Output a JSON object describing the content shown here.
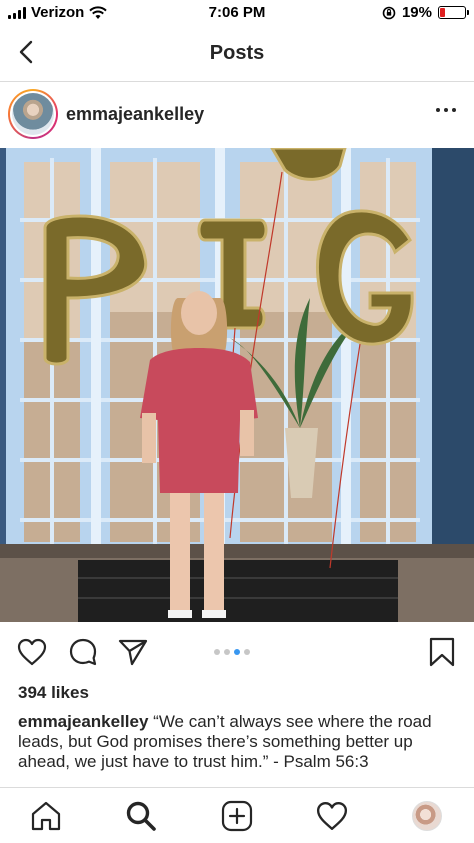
{
  "status_bar": {
    "carrier": "Verizon",
    "time": "7:06 PM",
    "battery": "19%",
    "battery_level": 0.19,
    "icons": [
      "signal-icon",
      "wifi-icon",
      "rotation-lock-icon",
      "battery-icon"
    ]
  },
  "header": {
    "title": "Posts",
    "back_icon": "chevron-left-icon"
  },
  "post": {
    "username": "emmajeankelley",
    "more_icon": "more-horizontal-icon",
    "photo_alt": "photo",
    "carousel": {
      "count": 4,
      "active_index": 2
    },
    "likes": "394 likes",
    "caption_user": "emmajeankelley",
    "caption_text": "“We can’t always see where the road leads, but God promises there’s something better up ahead, we just have to trust him.” - Psalm 56:3",
    "action_icons": [
      "heart-icon",
      "comment-icon",
      "share-icon",
      "bookmark-icon"
    ]
  },
  "tab_bar": {
    "tabs": [
      "home-icon",
      "search-icon",
      "new-post-icon",
      "activity-icon",
      "profile-avatar"
    ]
  },
  "colors": {
    "accent": "#3897f0",
    "text": "#262626",
    "divider": "#dbdbdb",
    "battery_low": "#e02020"
  }
}
